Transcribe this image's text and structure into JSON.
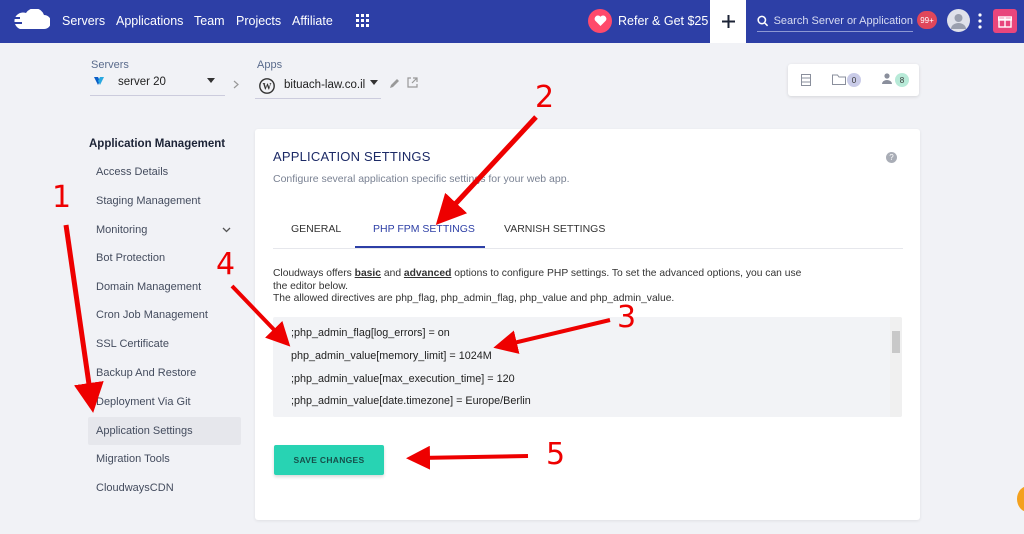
{
  "topbar": {
    "nav": [
      "Servers",
      "Applications",
      "Team",
      "Projects",
      "Affiliate"
    ],
    "refer_label": "Refer & Get $25",
    "search_placeholder": "Search Server or Application",
    "notif_count": "99+",
    "colors": {
      "bar": "#2d3fa6",
      "heart": "#ff4a6b",
      "gift": "#e8467c"
    }
  },
  "breadcrumb": {
    "servers_label": "Servers",
    "server_name": "server 20",
    "apps_label": "Apps",
    "app_name": "bituach-law.co.il"
  },
  "toolbar": {
    "files_count": "0",
    "users_count": "8"
  },
  "sidebar": {
    "heading": "Application Management",
    "items": [
      {
        "label": "Access Details"
      },
      {
        "label": "Staging Management"
      },
      {
        "label": "Monitoring"
      },
      {
        "label": "Bot Protection"
      },
      {
        "label": "Domain Management"
      },
      {
        "label": "Cron Job Management"
      },
      {
        "label": "SSL Certificate"
      },
      {
        "label": "Backup And Restore"
      },
      {
        "label": "Deployment Via Git"
      },
      {
        "label": "Application Settings",
        "active": true
      },
      {
        "label": "Migration Tools"
      },
      {
        "label": "CloudwaysCDN"
      }
    ]
  },
  "panel": {
    "title": "APPLICATION SETTINGS",
    "subtitle": "Configure several application specific settings for your web app.",
    "help": "?",
    "tabs": [
      "GENERAL",
      "PHP FPM SETTINGS",
      "VARNISH SETTINGS"
    ],
    "desc_1a": "Cloudways offers ",
    "desc_basic": "basic",
    "desc_1b": " and ",
    "desc_advanced": "advanced",
    "desc_1c": "  options to configure PHP settings. To set the advanced options, you can use the editor below.",
    "desc_2": "The allowed directives are php_flag, php_admin_flag, php_value and php_admin_value.",
    "code_lines": [
      ";php_admin_flag[log_errors] = on",
      "php_admin_value[memory_limit] = 1024M",
      ";php_admin_value[max_execution_time] = 120",
      ";php_admin_value[date.timezone] = Europe/Berlin"
    ],
    "save_label": "SAVE CHANGES"
  },
  "annotations": [
    "1",
    "2",
    "3",
    "4",
    "5"
  ]
}
